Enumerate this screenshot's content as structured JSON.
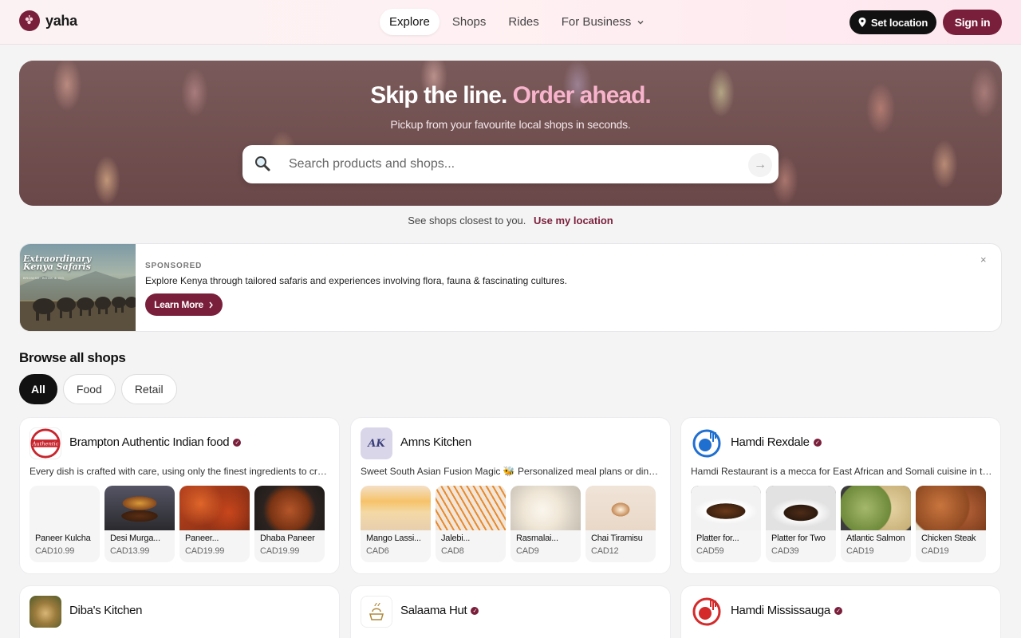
{
  "brand": {
    "name": "yaha"
  },
  "nav": {
    "items": [
      {
        "label": "Explore",
        "active": true
      },
      {
        "label": "Shops"
      },
      {
        "label": "Rides"
      },
      {
        "label": "For Business",
        "dropdown": true
      }
    ],
    "set_location": "Set location",
    "sign_in": "Sign in"
  },
  "hero": {
    "title_main": "Skip the line.",
    "title_accent": "Order ahead.",
    "subtitle": "Pickup from your favourite local shops in seconds.",
    "search_placeholder": "Search products and shops...",
    "search_icon": "magnifier-icon",
    "go_icon": "arrow-right-icon"
  },
  "location_prompt": {
    "text": "See shops closest to you.",
    "link": "Use my location"
  },
  "sponsored": {
    "image_title": "Extraordinary Kenya Safaris",
    "image_caption": "BROWSE. BOOK & GO.",
    "tag": "SPONSORED",
    "text": "Explore Kenya through tailored safaris and experiences involving flora, fauna & fascinating cultures.",
    "button": "Learn More",
    "close": "×"
  },
  "browse": {
    "title": "Browse all shops",
    "filters": [
      {
        "label": "All",
        "active": true
      },
      {
        "label": "Food"
      },
      {
        "label": "Retail"
      }
    ]
  },
  "colors": {
    "brand": "#7a1f3b",
    "accent": "#f8b4cc"
  },
  "shops": [
    {
      "name": "Brampton Authentic Indian food",
      "verified": true,
      "description": "Every dish is crafted with care, using only the finest ingredients to create...",
      "products": [
        {
          "name": "Paneer Kulcha",
          "price": "CAD10.99"
        },
        {
          "name": "Desi Murga...",
          "price": "CAD13.99"
        },
        {
          "name": "Paneer...",
          "price": "CAD19.99"
        },
        {
          "name": "Dhaba Paneer",
          "price": "CAD19.99"
        }
      ]
    },
    {
      "name": "Amns Kitchen",
      "logo_text": "AK",
      "verified": false,
      "description": "Sweet South Asian Fusion Magic 🐝 Personalized meal plans or dinners...",
      "products": [
        {
          "name": "Mango Lassi...",
          "price": "CAD6"
        },
        {
          "name": "Jalebi...",
          "price": "CAD8"
        },
        {
          "name": "Rasmalai...",
          "price": "CAD9"
        },
        {
          "name": "Chai Tiramisu",
          "price": "CAD12"
        }
      ]
    },
    {
      "name": "Hamdi Rexdale",
      "verified": true,
      "description": "Hamdi Restaurant is a mecca for East African and Somali cuisine in the...",
      "products": [
        {
          "name": "Platter for...",
          "price": "CAD59"
        },
        {
          "name": "Platter for Two",
          "price": "CAD39"
        },
        {
          "name": "Atlantic Salmon",
          "price": "CAD19"
        },
        {
          "name": "Chicken Steak",
          "price": "CAD19"
        }
      ]
    },
    {
      "name": "Diba's Kitchen",
      "verified": false
    },
    {
      "name": "Salaama Hut",
      "verified": true
    },
    {
      "name": "Hamdi Mississauga",
      "verified": true
    }
  ]
}
